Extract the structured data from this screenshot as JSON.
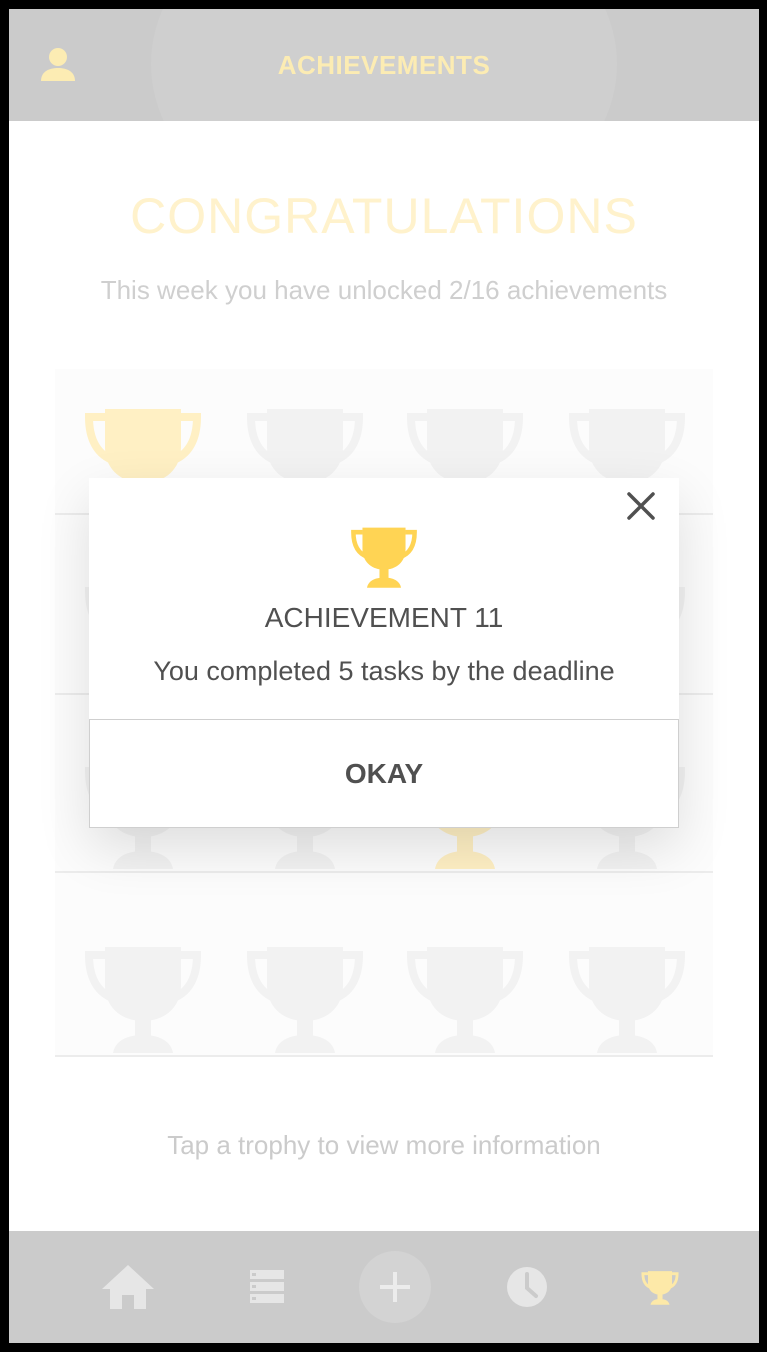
{
  "header": {
    "title": "ACHIEVEMENTS",
    "profile_icon": "person-icon"
  },
  "main": {
    "congrats": "CONGRATULATIONS",
    "subtitle": "This week you have unlocked 2/16 achievements",
    "hint": "Tap a trophy to view more information",
    "unlocked_count": 2,
    "total_count": 16
  },
  "modal": {
    "title": "ACHIEVEMENT 11",
    "description": "You completed 5 tasks by the deadline",
    "okay_label": "OKAY",
    "close_icon": "close-icon"
  },
  "nav": {
    "items": [
      "home-icon",
      "list-icon",
      "add-icon",
      "clock-icon",
      "trophy-icon"
    ],
    "active": "trophy-icon"
  },
  "colors": {
    "gold": "#ffd454",
    "gold_faded": "#fff0c4",
    "grey_bar": "#cbcbcb",
    "trophy_locked": "#f2f2f2",
    "text_dark": "#505050"
  }
}
